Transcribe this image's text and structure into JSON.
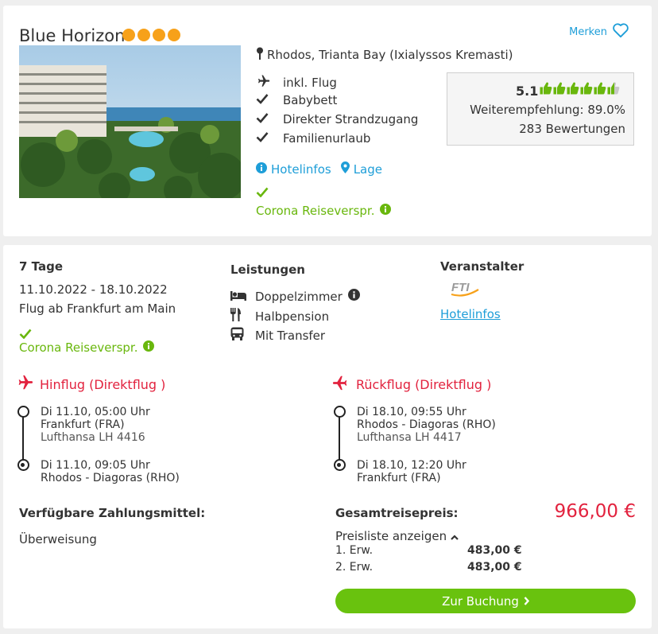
{
  "hotel": {
    "name": "Blue Horizon",
    "stars": 4,
    "merken_label": "Merken",
    "location": "Rhodos, Trianta Bay (Ixialyssos Kremasti)",
    "features": [
      "inkl. Flug",
      "Babybett",
      "Direkter Strandzugang",
      "Familienurlaub"
    ],
    "feature_icons": [
      "plane-icon",
      "check-icon",
      "check-icon",
      "check-icon"
    ],
    "hotelinfos_label": "Hotelinfos",
    "lage_label": "Lage",
    "corona_label": "Corona Reiseverspr.",
    "rating": {
      "score": "5.1",
      "thumbs_full": 5,
      "thumbs_half": 1,
      "thumbs_empty": 0,
      "recommendation": "Weiterempfehlung: 89.0%",
      "count": "283 Bewertungen"
    }
  },
  "offer": {
    "duration": "7 Tage",
    "dates": "11.10.2022 - 18.10.2022",
    "departure": "Flug ab Frankfurt am Main",
    "corona_label": "Corona Reiseverspr.",
    "services_title": "Leistungen",
    "services": [
      {
        "icon": "bed-icon",
        "label": "Doppelzimmer",
        "info": true
      },
      {
        "icon": "cutlery-icon",
        "label": "Halbpension",
        "info": false
      },
      {
        "icon": "bus-icon",
        "label": "Mit Transfer",
        "info": false
      }
    ],
    "operator_title": "Veranstalter",
    "operator_logo": "FTI",
    "operator_link": "Hotelinfos"
  },
  "outbound": {
    "title": "Hinflug (Direktflug )",
    "dep_time": "Di 11.10, 05:00 Uhr",
    "dep_airport": "Frankfurt (FRA)",
    "flight": "Lufthansa LH 4416",
    "arr_time": "Di 11.10, 09:05 Uhr",
    "arr_airport": "Rhodos - Diagoras (RHO)"
  },
  "return": {
    "title": "Rückflug (Direktflug )",
    "dep_time": "Di 18.10, 09:55 Uhr",
    "dep_airport": "Rhodos - Diagoras (RHO)",
    "flight": "Lufthansa LH 4417",
    "arr_time": "Di 18.10, 12:20 Uhr",
    "arr_airport": "Frankfurt (FRA)"
  },
  "payment": {
    "title": "Verfügbare Zahlungsmittel:",
    "method": "Überweisung"
  },
  "price": {
    "title": "Gesamtreisepreis:",
    "total": "966,00 €",
    "list_toggle": "Preisliste anzeigen",
    "rows": [
      {
        "label": "1. Erw.",
        "value": "483,00 €"
      },
      {
        "label": "2. Erw.",
        "value": "483,00 €"
      }
    ],
    "book_label": "Zur Buchung"
  },
  "colors": {
    "link_blue": "#1e9ed8",
    "accent_red": "#e2223e",
    "green": "#69b70d",
    "star_orange": "#f7a11a"
  }
}
